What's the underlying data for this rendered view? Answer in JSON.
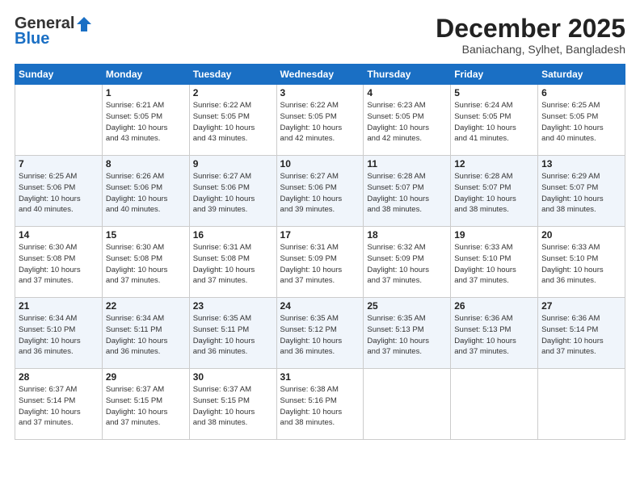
{
  "logo": {
    "general": "General",
    "blue": "Blue"
  },
  "title": "December 2025",
  "location": "Baniachang, Sylhet, Bangladesh",
  "headers": [
    "Sunday",
    "Monday",
    "Tuesday",
    "Wednesday",
    "Thursday",
    "Friday",
    "Saturday"
  ],
  "weeks": [
    [
      {
        "day": "",
        "info": ""
      },
      {
        "day": "1",
        "info": "Sunrise: 6:21 AM\nSunset: 5:05 PM\nDaylight: 10 hours\nand 43 minutes."
      },
      {
        "day": "2",
        "info": "Sunrise: 6:22 AM\nSunset: 5:05 PM\nDaylight: 10 hours\nand 43 minutes."
      },
      {
        "day": "3",
        "info": "Sunrise: 6:22 AM\nSunset: 5:05 PM\nDaylight: 10 hours\nand 42 minutes."
      },
      {
        "day": "4",
        "info": "Sunrise: 6:23 AM\nSunset: 5:05 PM\nDaylight: 10 hours\nand 42 minutes."
      },
      {
        "day": "5",
        "info": "Sunrise: 6:24 AM\nSunset: 5:05 PM\nDaylight: 10 hours\nand 41 minutes."
      },
      {
        "day": "6",
        "info": "Sunrise: 6:25 AM\nSunset: 5:05 PM\nDaylight: 10 hours\nand 40 minutes."
      }
    ],
    [
      {
        "day": "7",
        "info": "Sunrise: 6:25 AM\nSunset: 5:06 PM\nDaylight: 10 hours\nand 40 minutes."
      },
      {
        "day": "8",
        "info": "Sunrise: 6:26 AM\nSunset: 5:06 PM\nDaylight: 10 hours\nand 40 minutes."
      },
      {
        "day": "9",
        "info": "Sunrise: 6:27 AM\nSunset: 5:06 PM\nDaylight: 10 hours\nand 39 minutes."
      },
      {
        "day": "10",
        "info": "Sunrise: 6:27 AM\nSunset: 5:06 PM\nDaylight: 10 hours\nand 39 minutes."
      },
      {
        "day": "11",
        "info": "Sunrise: 6:28 AM\nSunset: 5:07 PM\nDaylight: 10 hours\nand 38 minutes."
      },
      {
        "day": "12",
        "info": "Sunrise: 6:28 AM\nSunset: 5:07 PM\nDaylight: 10 hours\nand 38 minutes."
      },
      {
        "day": "13",
        "info": "Sunrise: 6:29 AM\nSunset: 5:07 PM\nDaylight: 10 hours\nand 38 minutes."
      }
    ],
    [
      {
        "day": "14",
        "info": "Sunrise: 6:30 AM\nSunset: 5:08 PM\nDaylight: 10 hours\nand 37 minutes."
      },
      {
        "day": "15",
        "info": "Sunrise: 6:30 AM\nSunset: 5:08 PM\nDaylight: 10 hours\nand 37 minutes."
      },
      {
        "day": "16",
        "info": "Sunrise: 6:31 AM\nSunset: 5:08 PM\nDaylight: 10 hours\nand 37 minutes."
      },
      {
        "day": "17",
        "info": "Sunrise: 6:31 AM\nSunset: 5:09 PM\nDaylight: 10 hours\nand 37 minutes."
      },
      {
        "day": "18",
        "info": "Sunrise: 6:32 AM\nSunset: 5:09 PM\nDaylight: 10 hours\nand 37 minutes."
      },
      {
        "day": "19",
        "info": "Sunrise: 6:33 AM\nSunset: 5:10 PM\nDaylight: 10 hours\nand 37 minutes."
      },
      {
        "day": "20",
        "info": "Sunrise: 6:33 AM\nSunset: 5:10 PM\nDaylight: 10 hours\nand 36 minutes."
      }
    ],
    [
      {
        "day": "21",
        "info": "Sunrise: 6:34 AM\nSunset: 5:10 PM\nDaylight: 10 hours\nand 36 minutes."
      },
      {
        "day": "22",
        "info": "Sunrise: 6:34 AM\nSunset: 5:11 PM\nDaylight: 10 hours\nand 36 minutes."
      },
      {
        "day": "23",
        "info": "Sunrise: 6:35 AM\nSunset: 5:11 PM\nDaylight: 10 hours\nand 36 minutes."
      },
      {
        "day": "24",
        "info": "Sunrise: 6:35 AM\nSunset: 5:12 PM\nDaylight: 10 hours\nand 36 minutes."
      },
      {
        "day": "25",
        "info": "Sunrise: 6:35 AM\nSunset: 5:13 PM\nDaylight: 10 hours\nand 37 minutes."
      },
      {
        "day": "26",
        "info": "Sunrise: 6:36 AM\nSunset: 5:13 PM\nDaylight: 10 hours\nand 37 minutes."
      },
      {
        "day": "27",
        "info": "Sunrise: 6:36 AM\nSunset: 5:14 PM\nDaylight: 10 hours\nand 37 minutes."
      }
    ],
    [
      {
        "day": "28",
        "info": "Sunrise: 6:37 AM\nSunset: 5:14 PM\nDaylight: 10 hours\nand 37 minutes."
      },
      {
        "day": "29",
        "info": "Sunrise: 6:37 AM\nSunset: 5:15 PM\nDaylight: 10 hours\nand 37 minutes."
      },
      {
        "day": "30",
        "info": "Sunrise: 6:37 AM\nSunset: 5:15 PM\nDaylight: 10 hours\nand 38 minutes."
      },
      {
        "day": "31",
        "info": "Sunrise: 6:38 AM\nSunset: 5:16 PM\nDaylight: 10 hours\nand 38 minutes."
      },
      {
        "day": "",
        "info": ""
      },
      {
        "day": "",
        "info": ""
      },
      {
        "day": "",
        "info": ""
      }
    ]
  ]
}
